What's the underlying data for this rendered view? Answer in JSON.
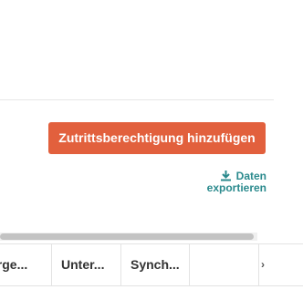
{
  "actions": {
    "add_access_button": "Zutrittsberechtigung hinzufügen",
    "export_link": "Daten exportieren",
    "export_icon": "download-icon",
    "accent_color": "#e2603d",
    "link_color": "#2b8a8d"
  },
  "table": {
    "columns": [
      {
        "label": "erge..."
      },
      {
        "label": "Unter..."
      },
      {
        "label": "Synch..."
      },
      {
        "label": ""
      },
      {
        "label": "›"
      }
    ]
  }
}
